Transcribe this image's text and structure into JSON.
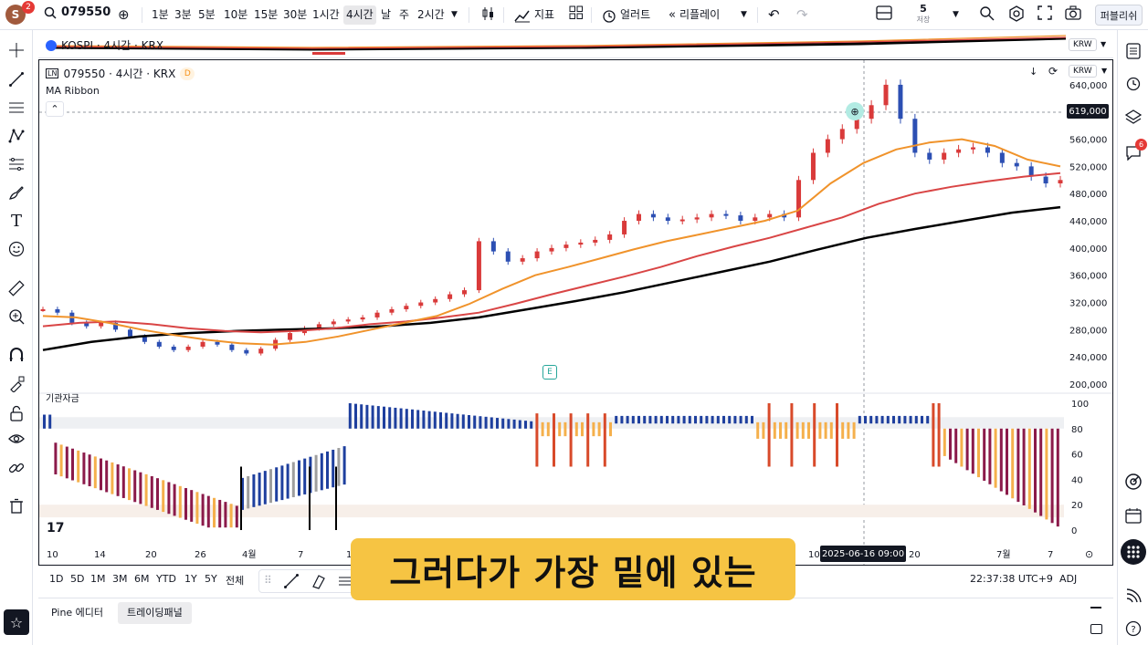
{
  "topbar": {
    "avatar_letter": "S",
    "avatar_badge": "2",
    "symbol": "079550",
    "intervals": [
      "1분",
      "3분",
      "5분",
      "10분",
      "15분",
      "30분",
      "1시간",
      "4시간",
      "날",
      "주",
      "2시간"
    ],
    "active_interval": "4시간",
    "indicators_label": "지표",
    "alert_label": "얼러트",
    "replay_label": "리플레이",
    "layout_count": "5",
    "layout_sub": "저장",
    "publish_label": "퍼블리쉬"
  },
  "kospi_legend": {
    "symbol": "KOSPI · 4시간 · KRX",
    "currency": "KRW"
  },
  "main_legend": {
    "title": "079550 · 4시간 · KRX",
    "badge": "D",
    "indicator": "MA Ribbon",
    "currency": "KRW"
  },
  "oscillator_label": "기관자금",
  "price_axis": [
    "640,000",
    "600,000",
    "560,000",
    "520,000",
    "480,000",
    "440,000",
    "400,000",
    "360,000",
    "320,000",
    "280,000",
    "240,000",
    "200,000"
  ],
  "current_price": "619,000",
  "osc_axis": [
    "100",
    "80",
    "60",
    "40",
    "20",
    "0"
  ],
  "time_axis": [
    "10",
    "14",
    "20",
    "26",
    "4월",
    "7",
    "1",
    "10",
    "20",
    "7월",
    "7"
  ],
  "crosshair_date": "2025-06-16   09:00",
  "earnings_marker": "E",
  "range_buttons": [
    "1D",
    "5D",
    "1M",
    "3M",
    "6M",
    "YTD",
    "1Y",
    "5Y",
    "전체"
  ],
  "clock": "22:37:38 UTC+9",
  "adj": "ADJ",
  "bottom_tabs": [
    "Pine 에디터",
    "트레이딩패널"
  ],
  "subtitle": "그러다가 가장 밑에 있는",
  "right_badge": "6",
  "colors": {
    "up": "#d93a3a",
    "down": "#2c4fb3",
    "ma_fast": "#f0932b",
    "ma_mid": "#d94545",
    "ma_slow": "#000000",
    "osc_blue": "#1e3f9e",
    "osc_red": "#d84a2a",
    "osc_maroon": "#8b1a4a",
    "osc_orange": "#f5b04c",
    "subtitle_bg": "#f6c443"
  },
  "chart_data": {
    "type": "candlestick",
    "title": "079550 · 4시간 · KRX",
    "ylim": [
      200000,
      660000
    ],
    "price_path": [
      310000,
      305000,
      290000,
      285000,
      290000,
      280000,
      270000,
      262000,
      255000,
      250000,
      255000,
      262000,
      258000,
      250000,
      245000,
      252000,
      265000,
      275000,
      282000,
      288000,
      292000,
      295000,
      298000,
      305000,
      310000,
      315000,
      320000,
      325000,
      332000,
      338000,
      410000,
      395000,
      380000,
      385000,
      395000,
      400000,
      405000,
      408000,
      412000,
      420000,
      440000,
      450000,
      445000,
      440000,
      442000,
      445000,
      450000,
      448000,
      440000,
      445000,
      450000,
      445000,
      500000,
      540000,
      560000,
      575000,
      590000,
      610000,
      640000,
      590000,
      540000,
      530000,
      540000,
      545000,
      548000,
      540000,
      525000,
      520000,
      505000,
      495000,
      500000
    ],
    "ma_fast_path": [
      300000,
      298000,
      290000,
      280000,
      272000,
      265000,
      260000,
      258000,
      262000,
      270000,
      280000,
      290000,
      300000,
      318000,
      340000,
      360000,
      372000,
      385000,
      398000,
      410000,
      420000,
      430000,
      440000,
      455000,
      495000,
      525000,
      545000,
      555000,
      560000,
      550000,
      530000,
      520000
    ],
    "ma_mid_path": [
      285000,
      290000,
      292000,
      288000,
      282000,
      278000,
      276000,
      278000,
      282000,
      288000,
      292000,
      298000,
      305000,
      318000,
      332000,
      345000,
      358000,
      372000,
      388000,
      402000,
      415000,
      430000,
      445000,
      465000,
      480000,
      490000,
      498000,
      505000,
      510000
    ],
    "ma_slow_path": [
      250000,
      262000,
      270000,
      275000,
      278000,
      280000,
      282000,
      285000,
      290000,
      298000,
      310000,
      322000,
      335000,
      350000,
      365000,
      380000,
      398000,
      415000,
      428000,
      440000,
      452000,
      460000
    ],
    "oscillator_ylim": [
      0,
      100
    ]
  }
}
